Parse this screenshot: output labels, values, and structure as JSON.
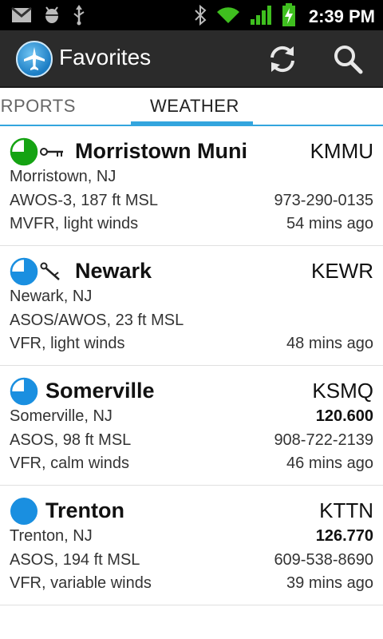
{
  "status_bar": {
    "time": "2:39 PM",
    "icons": [
      "gmail-icon",
      "android-debug-icon",
      "usb-icon",
      "bluetooth-icon",
      "wifi-icon",
      "signal-icon",
      "battery-charging-icon"
    ]
  },
  "action_bar": {
    "title": "Favorites",
    "icons": [
      "app-airplane-icon",
      "refresh-icon",
      "search-icon"
    ]
  },
  "tabs": [
    {
      "label": "IRPORTS",
      "selected": false
    },
    {
      "label": "WEATHER",
      "selected": true
    }
  ],
  "colors": {
    "accent": "#33a5de",
    "mvfr_green": "#15a313",
    "vfr_blue": "#1a8fe0",
    "action_bar": "#2b2b2b"
  },
  "favorites": [
    {
      "name": "Morristown Muni",
      "ident": "KMMU",
      "location": "Morristown, NJ",
      "weather_station": "AWOS-3, 187 ft MSL",
      "conditions": "MVFR, light winds",
      "frequency": "",
      "phone": "973-290-0135",
      "age": "54 mins ago",
      "flight_category": "MVFR",
      "sky_cover": "broken",
      "has_wind_barb": true
    },
    {
      "name": "Newark",
      "ident": "KEWR",
      "location": "Newark, NJ",
      "weather_station": "ASOS/AWOS, 23 ft MSL",
      "conditions": "VFR, light winds",
      "frequency": "",
      "phone": "",
      "age": "48 mins ago",
      "flight_category": "VFR",
      "sky_cover": "broken",
      "has_wind_barb": true
    },
    {
      "name": "Somerville",
      "ident": "KSMQ",
      "location": "Somerville, NJ",
      "weather_station": "ASOS, 98 ft MSL",
      "conditions": "VFR, calm winds",
      "frequency": "120.600",
      "phone": "908-722-2139",
      "age": "46 mins ago",
      "flight_category": "VFR",
      "sky_cover": "broken",
      "has_wind_barb": false
    },
    {
      "name": "Trenton",
      "ident": "KTTN",
      "location": "Trenton, NJ",
      "weather_station": "ASOS, 194 ft MSL",
      "conditions": "VFR, variable winds",
      "frequency": "126.770",
      "phone": "609-538-8690",
      "age": "39 mins ago",
      "flight_category": "VFR",
      "sky_cover": "overcast",
      "has_wind_barb": false
    }
  ]
}
